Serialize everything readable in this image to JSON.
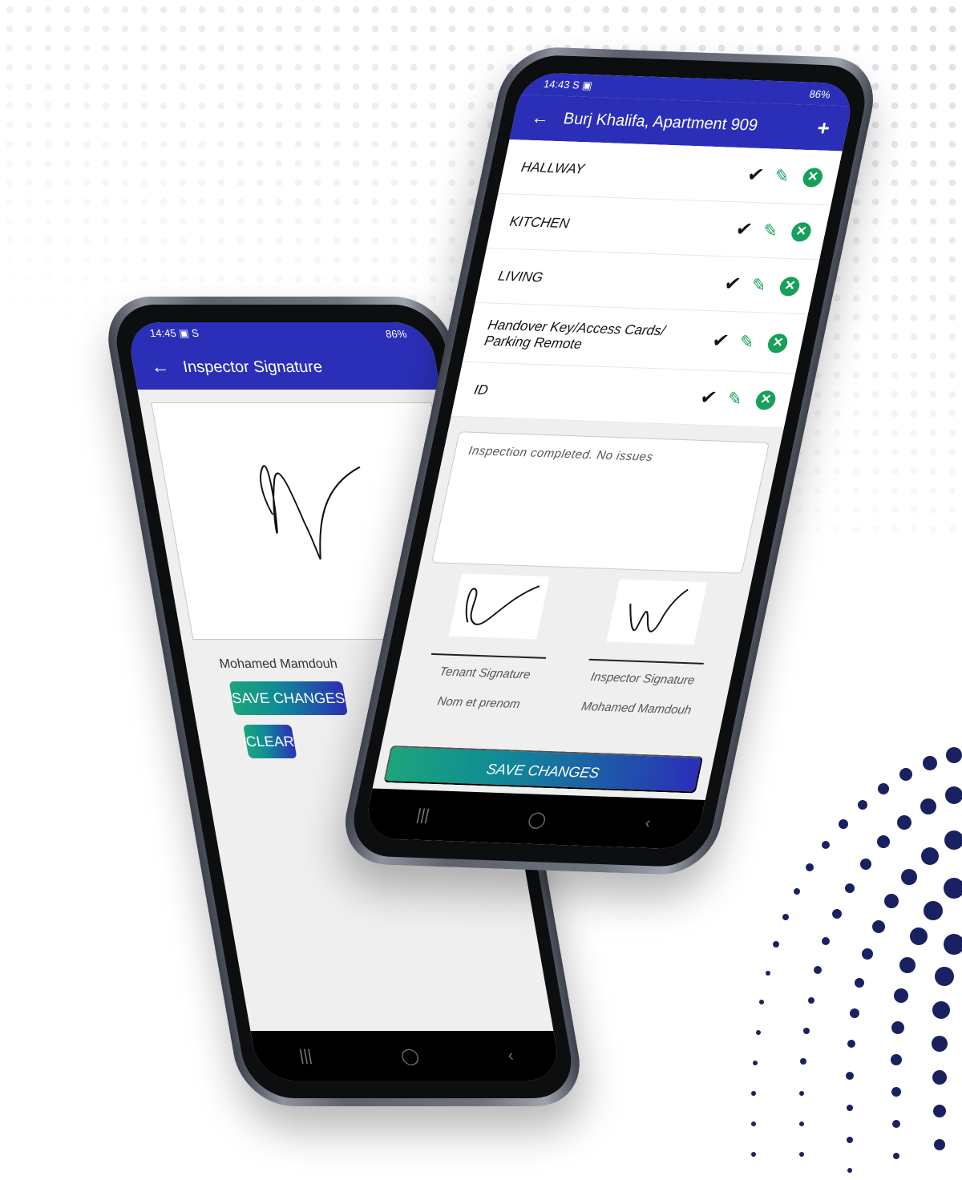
{
  "back_phone": {
    "status": {
      "time": "14:45",
      "left_icons": "▣ S",
      "battery": "86%"
    },
    "appbar": {
      "back_icon": "←",
      "title": "Inspector Signature"
    },
    "signer_name": "Mohamed Mamdouh",
    "save_label": "SAVE CHANGES",
    "clear_label": "CLEAR"
  },
  "front_phone": {
    "status": {
      "time": "14:43",
      "left_icons": "S ▣",
      "battery": "86%"
    },
    "appbar": {
      "back_icon": "←",
      "title": "Burj Khalifa, Apartment 909",
      "add_icon": "+"
    },
    "rooms": [
      {
        "name": "HALLWAY"
      },
      {
        "name": "KITCHEN"
      },
      {
        "name": "LIVING"
      },
      {
        "name": "Handover Key/Access Cards/ Parking Remote"
      },
      {
        "name": "ID"
      }
    ],
    "notes": "Inspection completed. No issues",
    "tenant": {
      "label": "Tenant Signature",
      "name": "Nom et prenom"
    },
    "inspector": {
      "label": "Inspector Signature",
      "name": "Mohamed Mamdouh"
    },
    "save_label": "SAVE CHANGES"
  },
  "icons": {
    "check": "✔",
    "edit": "✎",
    "delete": "✕",
    "nav_recent": "|||",
    "nav_home": "◯",
    "nav_back": "‹"
  },
  "colors": {
    "primary": "#2b2fb8",
    "accent_green": "#16a05a",
    "gradient_start": "#1ca57b"
  }
}
